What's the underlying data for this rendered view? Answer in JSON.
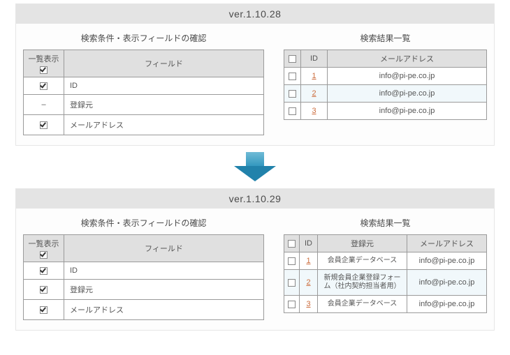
{
  "before": {
    "version": "ver.1.10.28",
    "left": {
      "title": "検索条件・表示フィールドの確認",
      "col_display": "一覧表示",
      "col_field": "フィールド",
      "rows": [
        {
          "checked": true,
          "dash": false,
          "field": "ID"
        },
        {
          "checked": false,
          "dash": true,
          "field": "登録元"
        },
        {
          "checked": true,
          "dash": false,
          "field": "メールアドレス"
        }
      ]
    },
    "right": {
      "title": "検索結果一覧",
      "col_id": "ID",
      "col_email": "メールアドレス",
      "rows": [
        {
          "id": "1",
          "email": "info@pi-pe.co.jp"
        },
        {
          "id": "2",
          "email": "info@pi-pe.co.jp"
        },
        {
          "id": "3",
          "email": "info@pi-pe.co.jp"
        }
      ]
    }
  },
  "after": {
    "version": "ver.1.10.29",
    "left": {
      "title": "検索条件・表示フィールドの確認",
      "col_display": "一覧表示",
      "col_field": "フィールド",
      "rows": [
        {
          "checked": true,
          "field": "ID"
        },
        {
          "checked": true,
          "field": "登録元"
        },
        {
          "checked": true,
          "field": "メールアドレス"
        }
      ]
    },
    "right": {
      "title": "検索結果一覧",
      "col_id": "ID",
      "col_origin": "登録元",
      "col_email": "メールアドレス",
      "rows": [
        {
          "id": "1",
          "origin": "会員企業データベース",
          "email": "info@pi-pe.co.jp"
        },
        {
          "id": "2",
          "origin": "新規会員企業登録フォーム（社内契約担当者用）",
          "email": "info@pi-pe.co.jp"
        },
        {
          "id": "3",
          "origin": "会員企業データベース",
          "email": "info@pi-pe.co.jp"
        }
      ]
    }
  },
  "dash": "–"
}
